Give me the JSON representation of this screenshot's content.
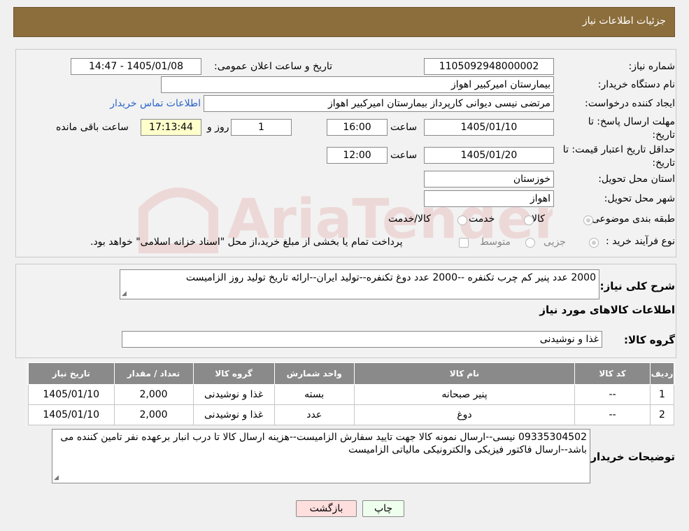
{
  "header": {
    "title": "جزئیات اطلاعات نیاز"
  },
  "info": {
    "need_number_label": "شماره نیاز:",
    "need_number": "1105092948000002",
    "announce_label": "تاریخ و ساعت اعلان عمومی:",
    "announce_value": "1405/01/08 - 14:47",
    "buyer_org_label": "نام دستگاه خریدار:",
    "buyer_org": "بیمارستان امیرکبیر اهواز",
    "creator_label": "ایجاد کننده درخواست:",
    "creator": "مرتضی نیسی دیوانی کارپرداز بیمارستان امیرکبیر اهواز",
    "contact_link": "اطلاعات تماس خریدار",
    "deadline_label": "مهلت ارسال پاسخ: تا تاریخ:",
    "deadline_date": "1405/01/10",
    "deadline_time_label": "ساعت",
    "deadline_time": "16:00",
    "days": "1",
    "days_label": "روز و",
    "remaining_time": "17:13:44",
    "remaining_label": "ساعت باقی مانده",
    "validity_label": "حداقل تاریخ اعتبار قیمت: تا تاریخ:",
    "validity_date": "1405/01/20",
    "validity_time_label": "ساعت",
    "validity_time": "12:00",
    "province_label": "استان محل تحویل:",
    "province": "خوزستان",
    "city_label": "شهر محل تحویل:",
    "city": "اهواز",
    "category_label": "طبقه بندی موضوعی:",
    "category_options": [
      "کالا",
      "خدمت",
      "کالا/خدمت"
    ],
    "process_label": "نوع فرآیند خرید :",
    "process_options": [
      "جزیی",
      "متوسط"
    ],
    "process_note": "پرداخت تمام یا بخشی از مبلغ خرید،از محل \"اسناد خزانه اسلامی\" خواهد بود."
  },
  "watermark": {
    "text": "AriaTender.neT"
  },
  "summary": {
    "label": "شرح کلی نیاز:",
    "text": "2000 عدد پنیر کم چرب تکنفره --2000 عدد دوغ تکنفره--تولید ایران--ارائه تاریخ تولید روز الزامیست",
    "items_title": "اطلاعات کالاهای مورد نیاز",
    "group_label": "گروه کالا:",
    "group_value": "غذا و نوشیدنی"
  },
  "table": {
    "headers": [
      "ردیف",
      "کد کالا",
      "نام کالا",
      "واحد شمارش",
      "گروه کالا",
      "تعداد / مقدار",
      "تاریخ نیاز"
    ],
    "rows": [
      [
        "1",
        "--",
        "پنیر صبحانه",
        "بسته",
        "غذا و نوشیدنی",
        "2,000",
        "1405/01/10"
      ],
      [
        "2",
        "--",
        "دوغ",
        "عدد",
        "غذا و نوشیدنی",
        "2,000",
        "1405/01/10"
      ]
    ]
  },
  "buyer_notes": {
    "label": "توضیحات خریدار:",
    "text": "09335304502 نیسی--ارسال نمونه کالا جهت تایید سفارش الزامیست--هزینه ارسال کالا تا درب انبار برعهده نفر تامین کننده می باشد--ارسال فاکتور فیزیکی والکترونیکی مالیاتی الزامیست"
  },
  "buttons": {
    "print": "چاپ",
    "back": "بازگشت"
  },
  "colors": {
    "header_bg": "#8c6e3c",
    "table_header_bg": "#8a8a8a",
    "link": "#2c64c8"
  }
}
